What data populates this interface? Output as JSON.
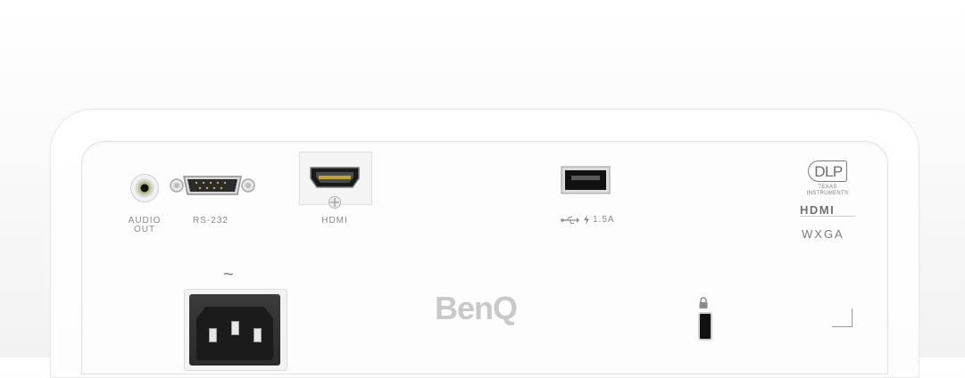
{
  "ports": {
    "audio_label_line1": "AUDIO",
    "audio_label_line2": "OUT",
    "rs232_label": "RS-232",
    "hdmi_label": "HDMI",
    "usb_rating": "1.5A",
    "power_symbol": "~"
  },
  "logos": {
    "dlp": "DLP",
    "dlp_sub": "TEXAS INSTRUMENTS",
    "hdmi": "HDMI",
    "resolution": "WXGA",
    "brand": "BenQ"
  },
  "colors": {
    "shell": "#ffffff",
    "port_black": "#111111",
    "label_gray": "#8a8a8a",
    "brand_gray": "#c9c9c9"
  },
  "icons": [
    "usb-icon",
    "lightning-icon",
    "lock-icon",
    "screw-icon"
  ]
}
